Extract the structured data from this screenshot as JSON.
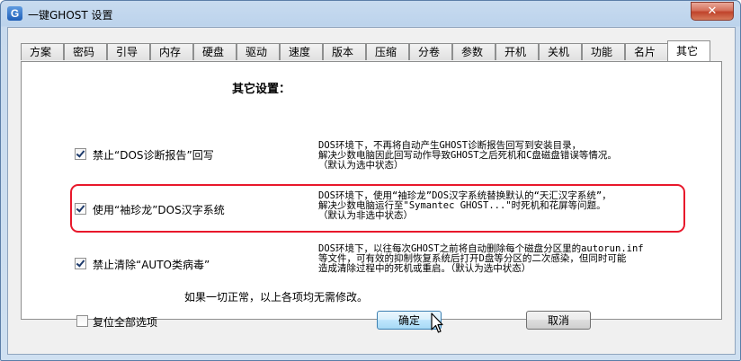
{
  "window": {
    "title": "一键GHOST 设置",
    "icon_letter": "G",
    "close_glyph": "✕"
  },
  "tabs": [
    {
      "label": "方案"
    },
    {
      "label": "密码"
    },
    {
      "label": "引导"
    },
    {
      "label": "内存"
    },
    {
      "label": "硬盘"
    },
    {
      "label": "驱动"
    },
    {
      "label": "速度"
    },
    {
      "label": "版本"
    },
    {
      "label": "压缩"
    },
    {
      "label": "分卷"
    },
    {
      "label": "参数"
    },
    {
      "label": "开机"
    },
    {
      "label": "关机"
    },
    {
      "label": "功能"
    },
    {
      "label": "名片"
    },
    {
      "label": "其它"
    }
  ],
  "active_tab": "其它",
  "panel": {
    "heading": "其它设置：",
    "options": [
      {
        "label": "禁止“DOS诊断报告”回写",
        "checked": true,
        "desc": [
          "DOS环境下，不再将自动产生GHOST诊断报告回写到安装目录，",
          "解决少数电脑因此回写动作导致GHOST之后死机和C盘磁盘错误等情况。",
          "（默认为选中状态）"
        ]
      },
      {
        "label": "使用“袖珍龙”DOS汉字系统",
        "checked": true,
        "desc": [
          "DOS环境下，使用“袖珍龙”DOS汉字系统替换默认的“天汇汉字系统”，",
          "解决少数电脑运行至\"Symantec GHOST...\"时死机和花屏等问题。",
          "（默认为非选中状态）"
        ]
      },
      {
        "label": "禁止清除“AUTO类病毒”",
        "checked": true,
        "desc": [
          "DOS环境下，以往每次GHOST之前将自动删除每个磁盘分区里的autorun.inf",
          "等文件，可有效的抑制恢复系统后打开D盘等分区的二次感染，但同时可能",
          "造成清除过程中的死机或重启。（默认为选中状态）"
        ]
      }
    ],
    "note": "如果一切正常，以上各项均无需修改。"
  },
  "footer": {
    "reset_label": "复位全部选项",
    "reset_checked": false,
    "ok_label": "确定",
    "cancel_label": "取消"
  },
  "colors": {
    "highlight_border": "#e8182b",
    "title_bar": "#c8dbef",
    "close_button": "#c0432b"
  }
}
